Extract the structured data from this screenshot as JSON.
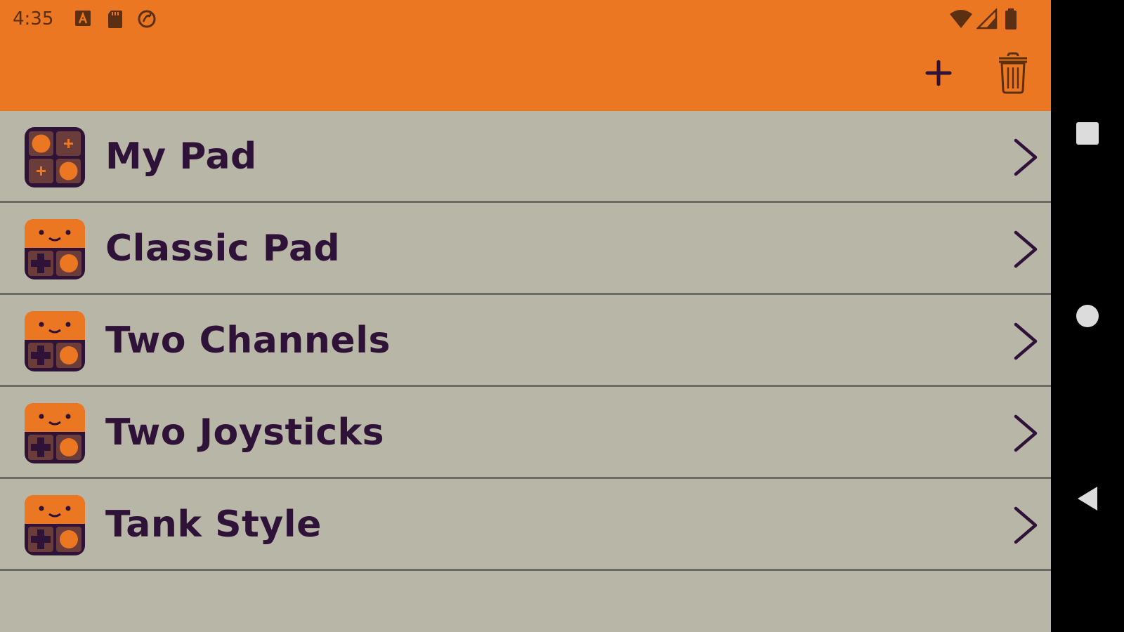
{
  "status_bar": {
    "time": "4:35",
    "left_icons": [
      "a-notification-icon",
      "sd-card-icon",
      "sync-icon"
    ],
    "right_icons": [
      "wifi-icon",
      "signal-icon",
      "battery-icon"
    ]
  },
  "toolbar": {
    "actions": [
      "add-icon",
      "trash-icon"
    ]
  },
  "pads": [
    {
      "label": "My Pad",
      "icon": "custom-pad-icon"
    },
    {
      "label": "Classic Pad",
      "icon": "gamepad-face-icon"
    },
    {
      "label": "Two Channels",
      "icon": "gamepad-face-icon"
    },
    {
      "label": "Two Joysticks",
      "icon": "gamepad-face-icon"
    },
    {
      "label": "Tank Style",
      "icon": "gamepad-face-icon"
    }
  ],
  "navigation": [
    "recents-icon",
    "home-icon",
    "back-icon"
  ],
  "colors": {
    "appbar": "#ec7722",
    "background": "#b8b6a6",
    "text": "#2e1238",
    "navbar": "#000000"
  }
}
